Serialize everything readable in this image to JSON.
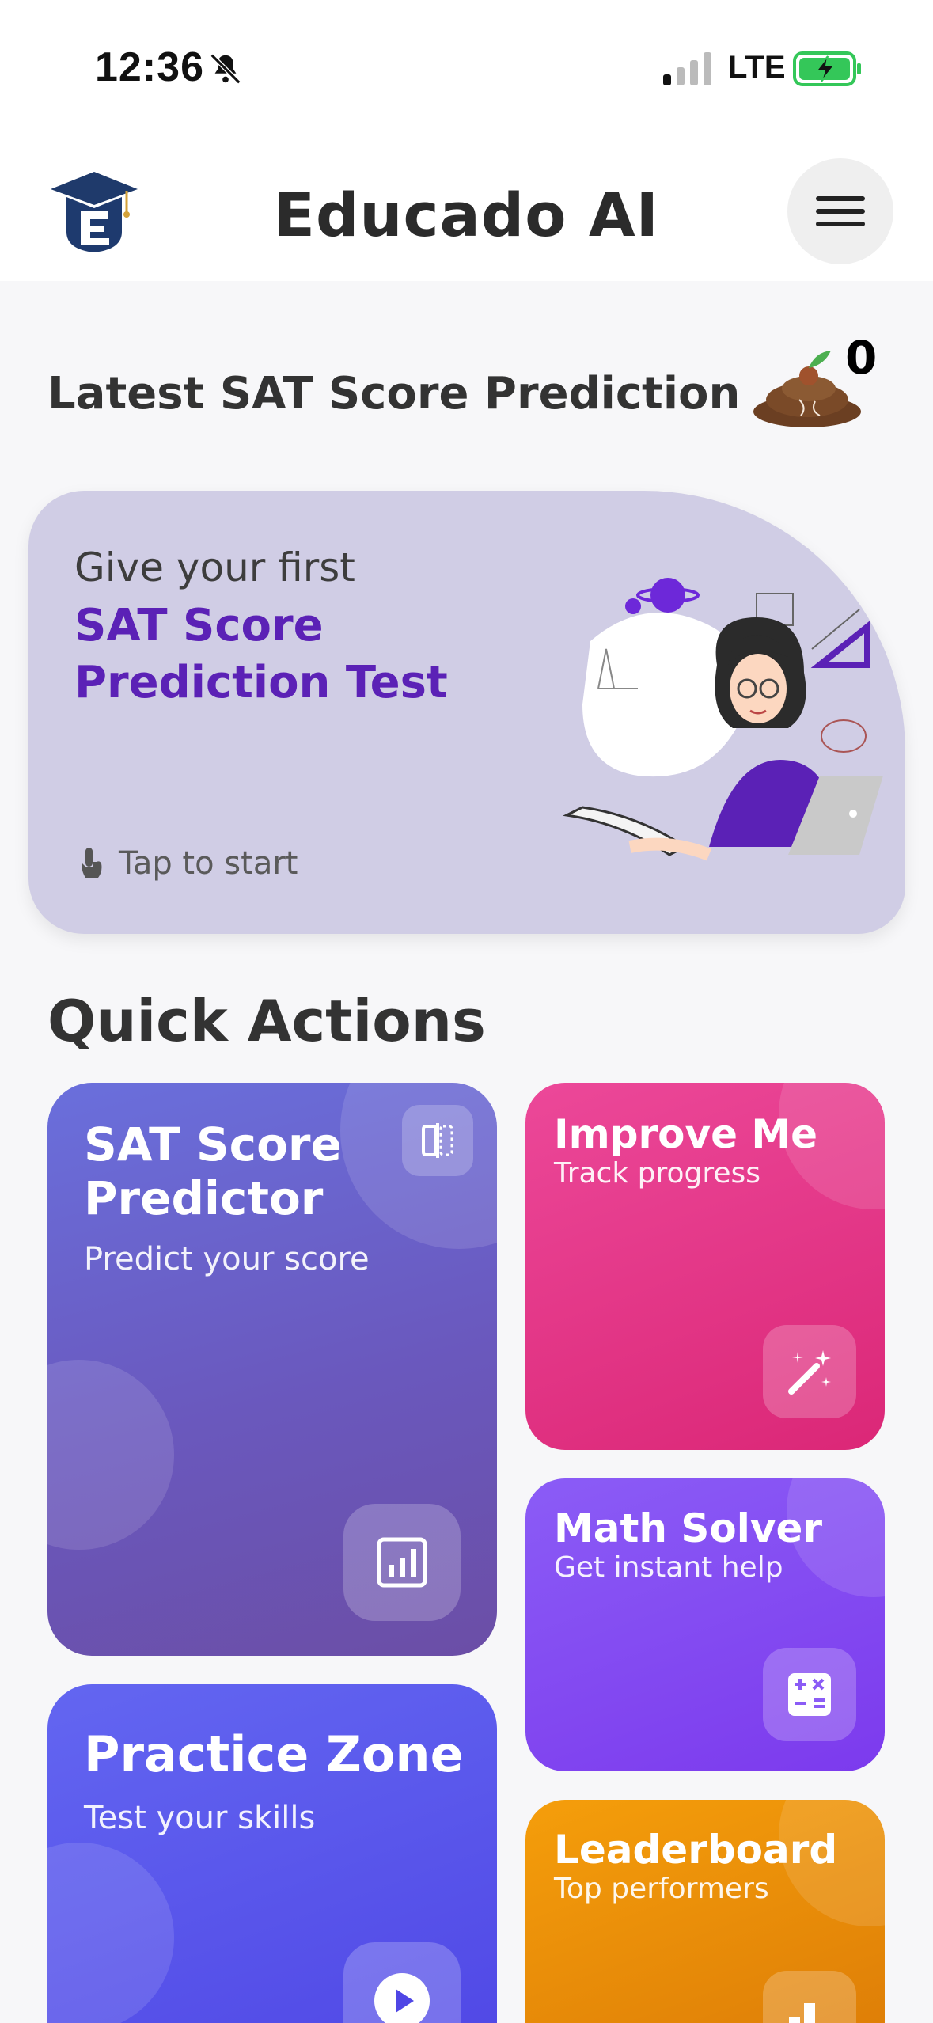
{
  "status_bar": {
    "time": "12:36",
    "network": "LTE"
  },
  "header": {
    "title": "Educado AI"
  },
  "prediction_section": {
    "title": "Latest SAT Score Prediction",
    "streak_count": "0",
    "card": {
      "line1": "Give your first",
      "line2": "SAT Score Prediction Test",
      "tap_label": "Tap to start"
    }
  },
  "quick_actions": {
    "title": "Quick Actions",
    "cards": [
      {
        "title": "SAT Score Predictor",
        "subtitle": "Predict your score",
        "icon": "bar-chart-icon",
        "color": "#6a58bd"
      },
      {
        "title": "Improve Me",
        "subtitle": "Track progress",
        "icon": "magic-wand-icon",
        "color": "#e23b8a"
      },
      {
        "title": "Math Solver",
        "subtitle": "Get instant help",
        "icon": "calculator-icon",
        "color": "#8b5cf6"
      },
      {
        "title": "Practice Zone",
        "subtitle": "Test your skills",
        "icon": "play-icon",
        "color": "#5b5cf0"
      },
      {
        "title": "Leaderboard",
        "subtitle": "Top performers",
        "icon": "podium-icon",
        "color": "#f08c0a"
      }
    ]
  }
}
